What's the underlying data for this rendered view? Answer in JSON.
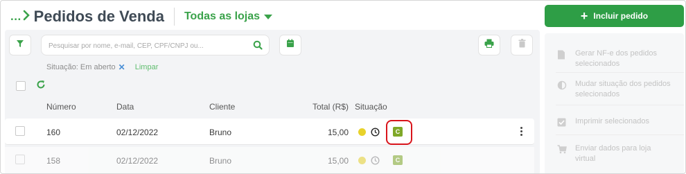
{
  "header": {
    "breadcrumb_dots": "...",
    "title": "Pedidos de Venda",
    "store_selector": "Todas as lojas"
  },
  "add_button": {
    "label": "Incluir pedido"
  },
  "search": {
    "placeholder": "Pesquisar por nome, e-mail, CEP, CPF/CNPJ ou..."
  },
  "filters": {
    "status_text": "Situação: Em aberto",
    "clear_label": "Limpar"
  },
  "table": {
    "columns": {
      "number": "Número",
      "date": "Data",
      "client": "Cliente",
      "total": "Total (R$)",
      "status": "Situação"
    },
    "rows": [
      {
        "number": "160",
        "date": "02/12/2022",
        "client": "Bruno",
        "total": "15,00",
        "badge": "C"
      },
      {
        "number": "158",
        "date": "02/12/2022",
        "client": "Bruno",
        "total": "15,00",
        "badge": "C"
      }
    ]
  },
  "actions": [
    {
      "label": "Gerar NF-e dos pedidos selecionados",
      "icon": "document-icon"
    },
    {
      "label": "Mudar situação dos pedidos selecionados",
      "icon": "half-circle-icon"
    },
    {
      "label": "Imprimir selecionados",
      "icon": "checkbox-icon"
    },
    {
      "label": "Enviar dados para loja virtual",
      "icon": "cart-icon"
    }
  ],
  "colors": {
    "brand_green": "#2e9e46",
    "status_yellow": "#e8d22b",
    "badge_green": "#7fa828",
    "highlight_red": "#d9141b"
  }
}
